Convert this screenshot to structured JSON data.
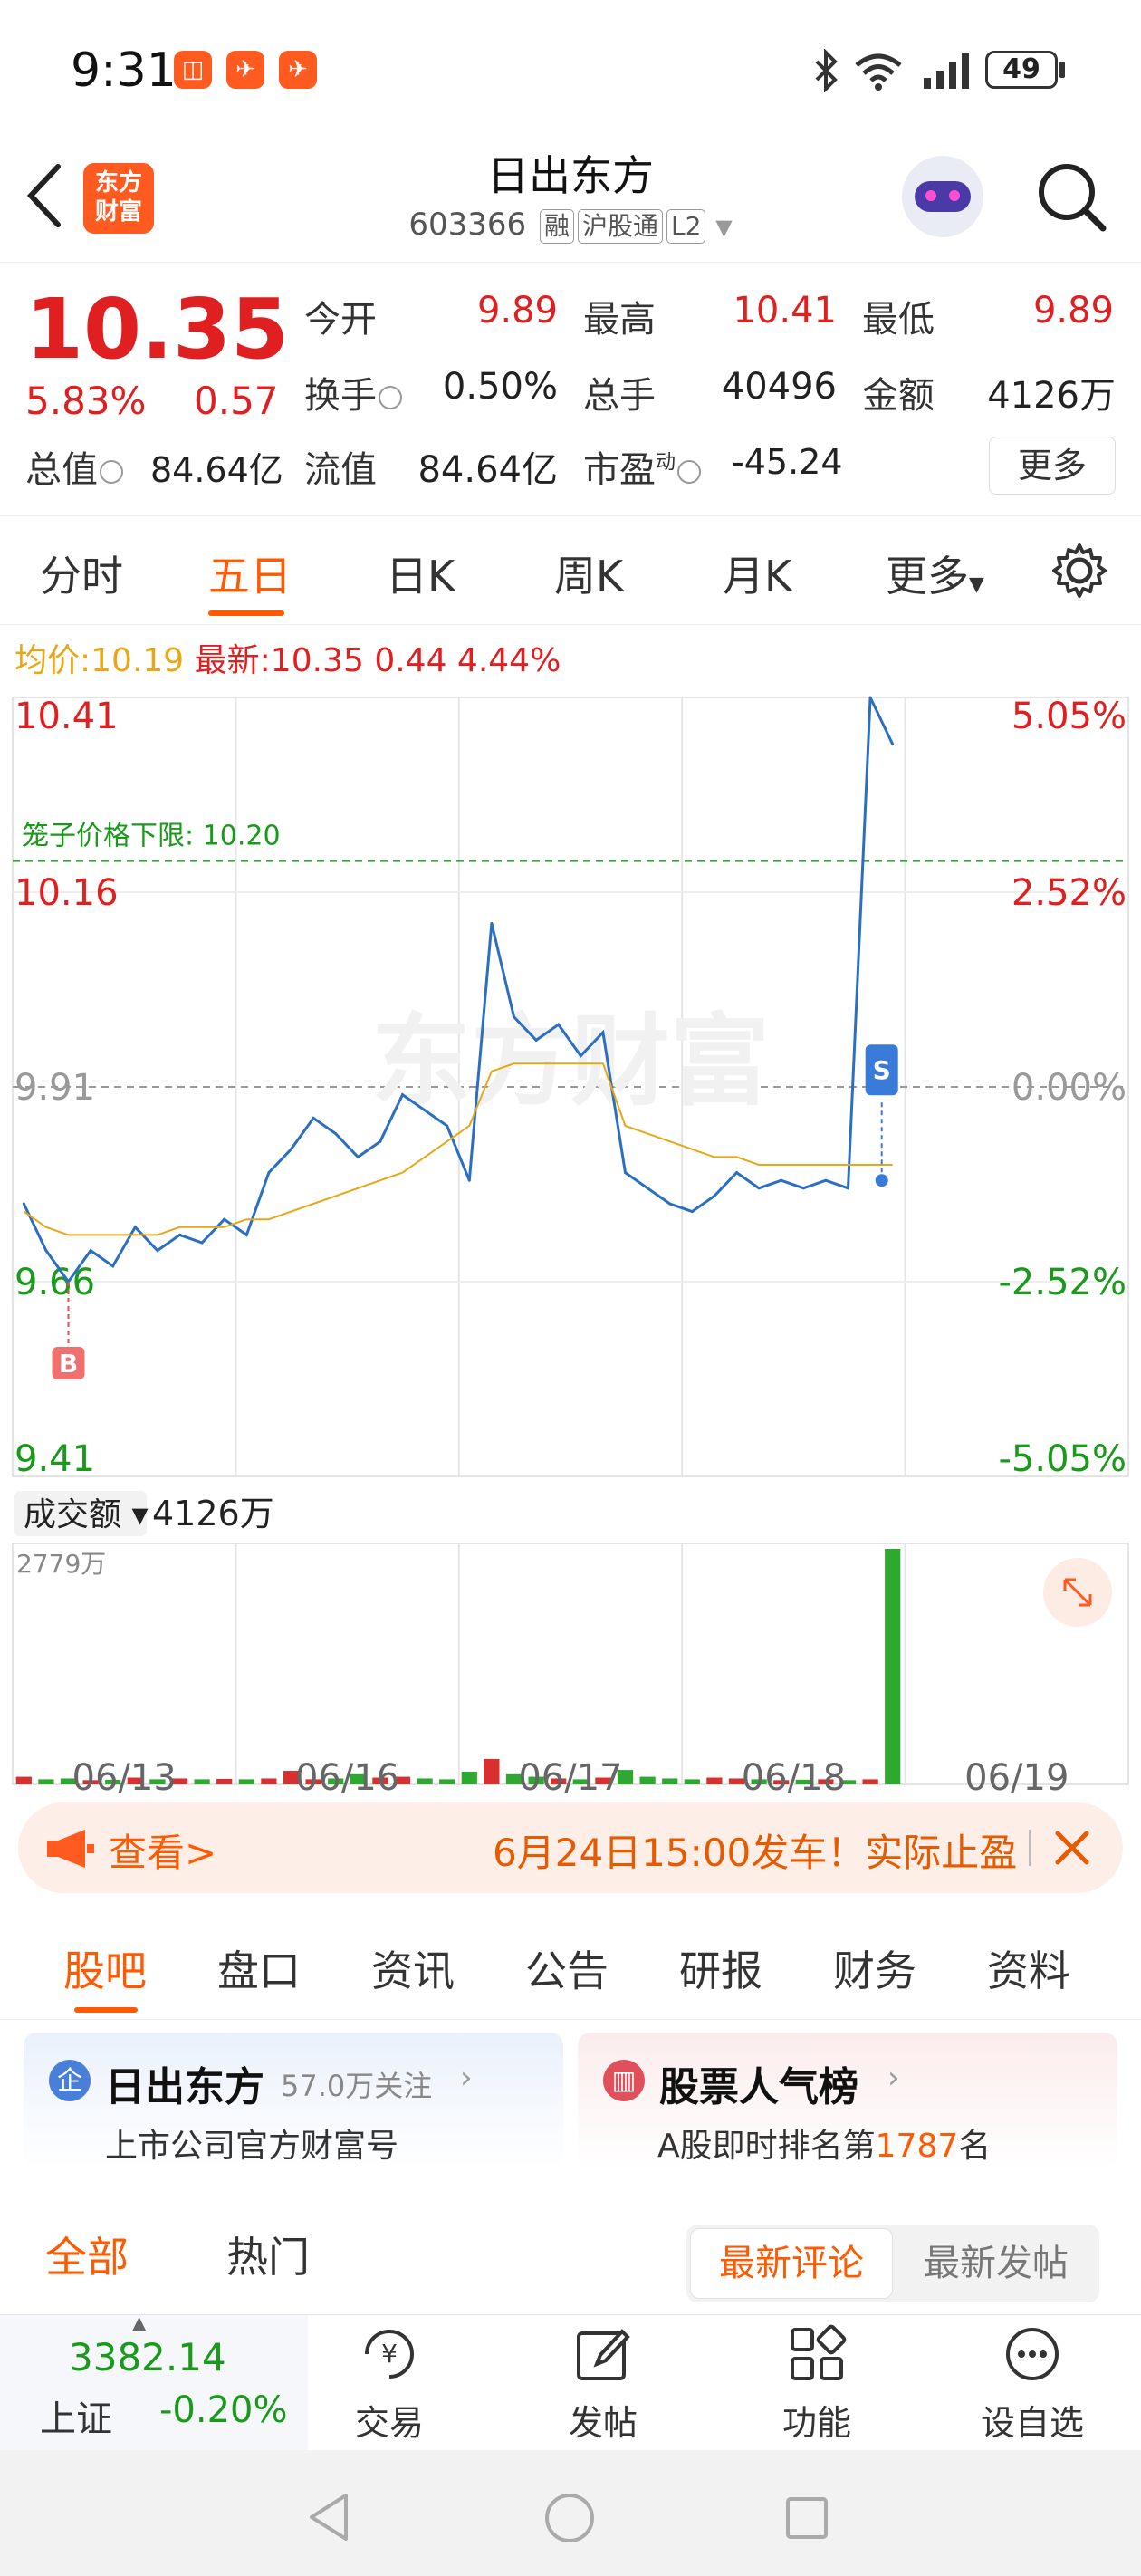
{
  "status_bar": {
    "time": "9:31",
    "battery": "49"
  },
  "header": {
    "logo_line1": "东方",
    "logo_line2": "财富",
    "stock_name": "日出东方",
    "stock_code": "603366",
    "tags": [
      "融",
      "沪股通",
      "L2"
    ]
  },
  "quote": {
    "price": "10.35",
    "change_pct": "5.83%",
    "change": "0.57",
    "fields": {
      "open_label": "今开",
      "open": "9.89",
      "high_label": "最高",
      "high": "10.41",
      "low_label": "最低",
      "low": "9.89",
      "turnover_label": "换手",
      "turnover": "0.50%",
      "volume_label": "总手",
      "volume": "40496",
      "amount_label": "金额",
      "amount": "4126万",
      "mktcap_label": "总值",
      "mktcap": "84.64亿",
      "float_label": "流值",
      "float": "84.64亿",
      "pe_label": "市盈",
      "pe_sup": "动",
      "pe": "-45.24"
    },
    "more_label": "更多"
  },
  "period_tabs": [
    "分时",
    "五日",
    "日K",
    "周K",
    "月K",
    "更多"
  ],
  "period_active": 1,
  "chart_info": {
    "avg_label": "均价:",
    "avg": "10.19",
    "latest_label": "最新:",
    "latest": "10.35",
    "latest_change": "0.44",
    "latest_pct": "4.44%",
    "limit_label": "笼子价格下限:",
    "limit_value": "10.20",
    "watermark": "东方财富",
    "volume_selector": "成交额",
    "volume_total": "4126万",
    "volume_axis_max": "2779万",
    "buy_marker": "B",
    "sell_marker": "S"
  },
  "chart_data": {
    "type": "line",
    "y_axis_left": [
      "10.41",
      "10.16",
      "9.91",
      "9.66",
      "9.41"
    ],
    "y_axis_right": [
      "5.05%",
      "2.52%",
      "0.00%",
      "-2.52%",
      "-5.05%"
    ],
    "x": [
      "06/13",
      "06/16",
      "06/17",
      "06/18",
      "06/19"
    ],
    "ylim": [
      9.41,
      10.41
    ],
    "reference_price": 9.91,
    "series": [
      {
        "values": [
          9.76,
          9.7,
          9.66,
          9.7,
          9.68,
          9.73,
          9.7,
          9.72,
          9.71,
          9.74,
          9.72,
          9.8,
          9.83,
          9.87,
          9.85,
          9.82,
          9.84,
          9.9,
          9.88,
          9.86,
          9.79,
          10.12,
          10.0,
          9.97,
          9.99,
          9.95,
          9.98,
          9.8,
          9.78,
          9.76,
          9.75,
          9.77,
          9.8,
          9.78,
          9.79,
          9.78,
          9.79,
          9.78,
          10.41,
          10.35
        ]
      },
      {
        "values": [
          9.75,
          9.73,
          9.72,
          9.72,
          9.72,
          9.72,
          9.72,
          9.73,
          9.73,
          9.73,
          9.74,
          9.74,
          9.75,
          9.76,
          9.77,
          9.78,
          9.79,
          9.8,
          9.82,
          9.84,
          9.86,
          9.93,
          9.94,
          9.94,
          9.94,
          9.94,
          9.94,
          9.86,
          9.85,
          9.84,
          9.83,
          9.82,
          9.82,
          9.81,
          9.81,
          9.81,
          9.81,
          9.81,
          9.81,
          9.81
        ]
      }
    ],
    "volume_values": [
      90,
      60,
      70,
      50,
      55,
      80,
      60,
      70,
      60,
      65,
      60,
      70,
      160,
      60,
      70,
      120,
      80,
      90,
      70,
      60,
      150,
      300,
      120,
      90,
      70,
      60,
      80,
      170,
      90,
      70,
      60,
      80,
      70,
      60,
      50,
      55,
      60,
      50,
      60,
      2779
    ]
  },
  "banner": {
    "link": "查看>",
    "text": "6月24日15:00发车！实际止盈"
  },
  "section_tabs": [
    "股吧",
    "盘口",
    "资讯",
    "公告",
    "研报",
    "财务",
    "资料"
  ],
  "cards": {
    "left_title": "日出东方",
    "left_follow": "57.0万关注",
    "left_sub": "上市公司官方财富号",
    "right_title": "股票人气榜",
    "right_sub_pre": "A股即时排名第",
    "right_rank": "1787",
    "right_sub_post": "名"
  },
  "feed_tabs": {
    "all": "全部",
    "hot": "热门",
    "latest_comment": "最新评论",
    "latest_post": "最新发帖"
  },
  "bottom_nav": {
    "index_value": "3382.14",
    "index_name": "上证",
    "index_change": "-0.20%",
    "items": [
      "交易",
      "发帖",
      "功能",
      "设自选"
    ]
  },
  "colors": {
    "accent": "#ff5a00",
    "up": "#e02020",
    "down": "#1a9a1a",
    "avg_line": "#e6a817",
    "price_line": "#2b6fc2"
  }
}
